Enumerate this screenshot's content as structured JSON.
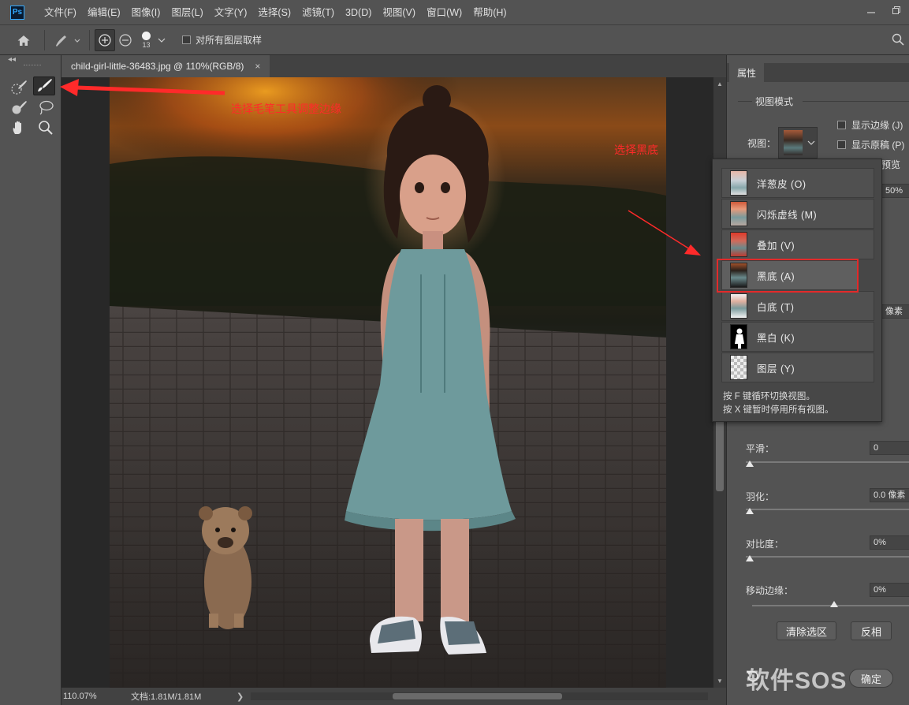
{
  "app": {
    "logo": "Ps"
  },
  "menu": [
    "文件(F)",
    "编辑(E)",
    "图像(I)",
    "图层(L)",
    "文字(Y)",
    "选择(S)",
    "滤镜(T)",
    "3D(D)",
    "视图(V)",
    "窗口(W)",
    "帮助(H)"
  ],
  "options": {
    "brush_size": "13",
    "sample_all_label": "对所有图层取样",
    "sample_all_checked": false
  },
  "document": {
    "tab_title": "child-girl-little-36483.jpg @ 110%(RGB/8)",
    "close": "×"
  },
  "annotations": {
    "brush_note": "选择毛笔工具调整边缘",
    "black_note": "选择黑底",
    "accent": "#ff2a2a"
  },
  "status": {
    "zoom": "110.07%",
    "doc_info": "文档:1.81M/1.81M",
    "arrow": "❯"
  },
  "panel": {
    "tab": "属性",
    "view_mode_title": "视图模式",
    "view_label": "视图：",
    "show_edge": "显示边缘 (J)",
    "show_original": "显示原稿 (P)",
    "preview_partial": "预览",
    "opacity_partial": "50%",
    "radius_partial": "像素",
    "smooth_label": "平滑：",
    "smooth_value": "0",
    "feather_label": "羽化：",
    "feather_value": "0.0 像素",
    "contrast_label": "对比度：",
    "contrast_value": "0%",
    "shift_label": "移动边缘：",
    "shift_value": "0%",
    "clear_btn": "清除选区",
    "invert_btn": "反相",
    "ok_btn": "确定"
  },
  "view_popup": {
    "items": [
      {
        "label": "洋葱皮 (O)"
      },
      {
        "label": "闪烁虚线 (M)"
      },
      {
        "label": "叠加 (V)"
      },
      {
        "label": "黑底 (A)",
        "selected": true
      },
      {
        "label": "白底 (T)"
      },
      {
        "label": "黑白 (K)"
      },
      {
        "label": "图层 (Y)"
      }
    ],
    "hint1": "按 F 键循环切换视图。",
    "hint2": "按 X 键暂时停用所有视图。"
  },
  "watermark": "软件SOS"
}
